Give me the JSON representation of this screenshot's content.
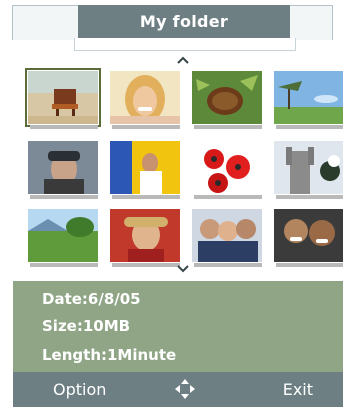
{
  "header": {
    "title": "My folder"
  },
  "nav": {
    "up_icon": "chevron-up-icon",
    "down_icon": "chevron-down-icon"
  },
  "gallery": {
    "selected_index": 0,
    "thumbnails": [
      {
        "name": "beach-chair"
      },
      {
        "name": "smiling-woman"
      },
      {
        "name": "pinecone"
      },
      {
        "name": "landscape-tree"
      },
      {
        "name": "man-in-cap"
      },
      {
        "name": "person-yellow-background"
      },
      {
        "name": "red-flowers"
      },
      {
        "name": "gothic-building"
      },
      {
        "name": "countryside"
      },
      {
        "name": "woman-in-hat"
      },
      {
        "name": "group-of-friends"
      },
      {
        "name": "two-men-laughing"
      }
    ]
  },
  "details": {
    "date": "Date:6/8/05",
    "size": "Size:10MB",
    "length": "Length:1Minute"
  },
  "softkeys": {
    "left": "Option",
    "center_icon": "dpad-icon",
    "right": "Exit"
  },
  "colors": {
    "title_bar": "#6e7f83",
    "info_panel": "#8fa586",
    "softkey_bar": "#6e7f83"
  }
}
